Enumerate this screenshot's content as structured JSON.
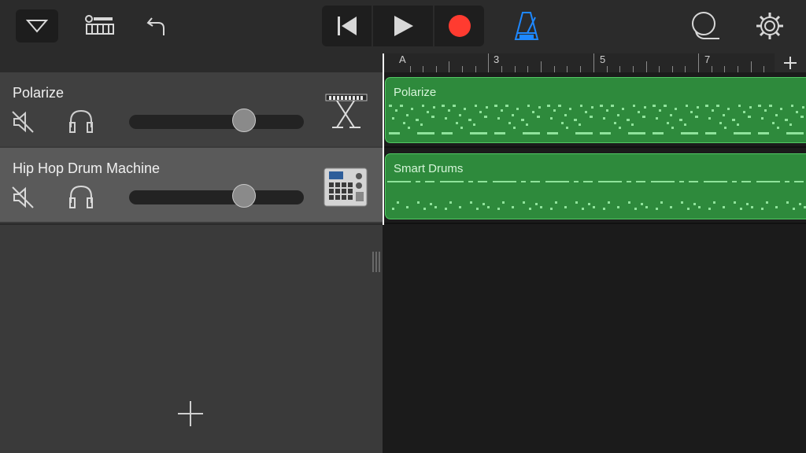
{
  "app": {
    "accent_green": "#2e8a3c",
    "record_color": "#ff3b30",
    "metronome_color": "#1e88ff"
  },
  "toolbar": {
    "left_icons": [
      "tracks-view-menu-icon",
      "mixer-icon",
      "undo-icon"
    ],
    "transport_icons": [
      "go-to-beginning-icon",
      "play-icon",
      "record-icon"
    ],
    "metronome_icon": "metronome-icon",
    "right_icons": [
      "loop-browser-icon",
      "settings-gear-icon"
    ]
  },
  "ruler": {
    "marker": "A",
    "bar_numbers": [
      "3",
      "5",
      "7"
    ],
    "add_label": "+"
  },
  "tracks": [
    {
      "name": "Polarize",
      "instrument_icon": "keyboard-synth-icon",
      "volume": 0.68,
      "region_name": "Polarize"
    },
    {
      "name": "Hip Hop Drum Machine",
      "instrument_icon": "drum-machine-icon",
      "volume": 0.68,
      "region_name": "Smart Drums"
    }
  ],
  "add_track_label": "+"
}
